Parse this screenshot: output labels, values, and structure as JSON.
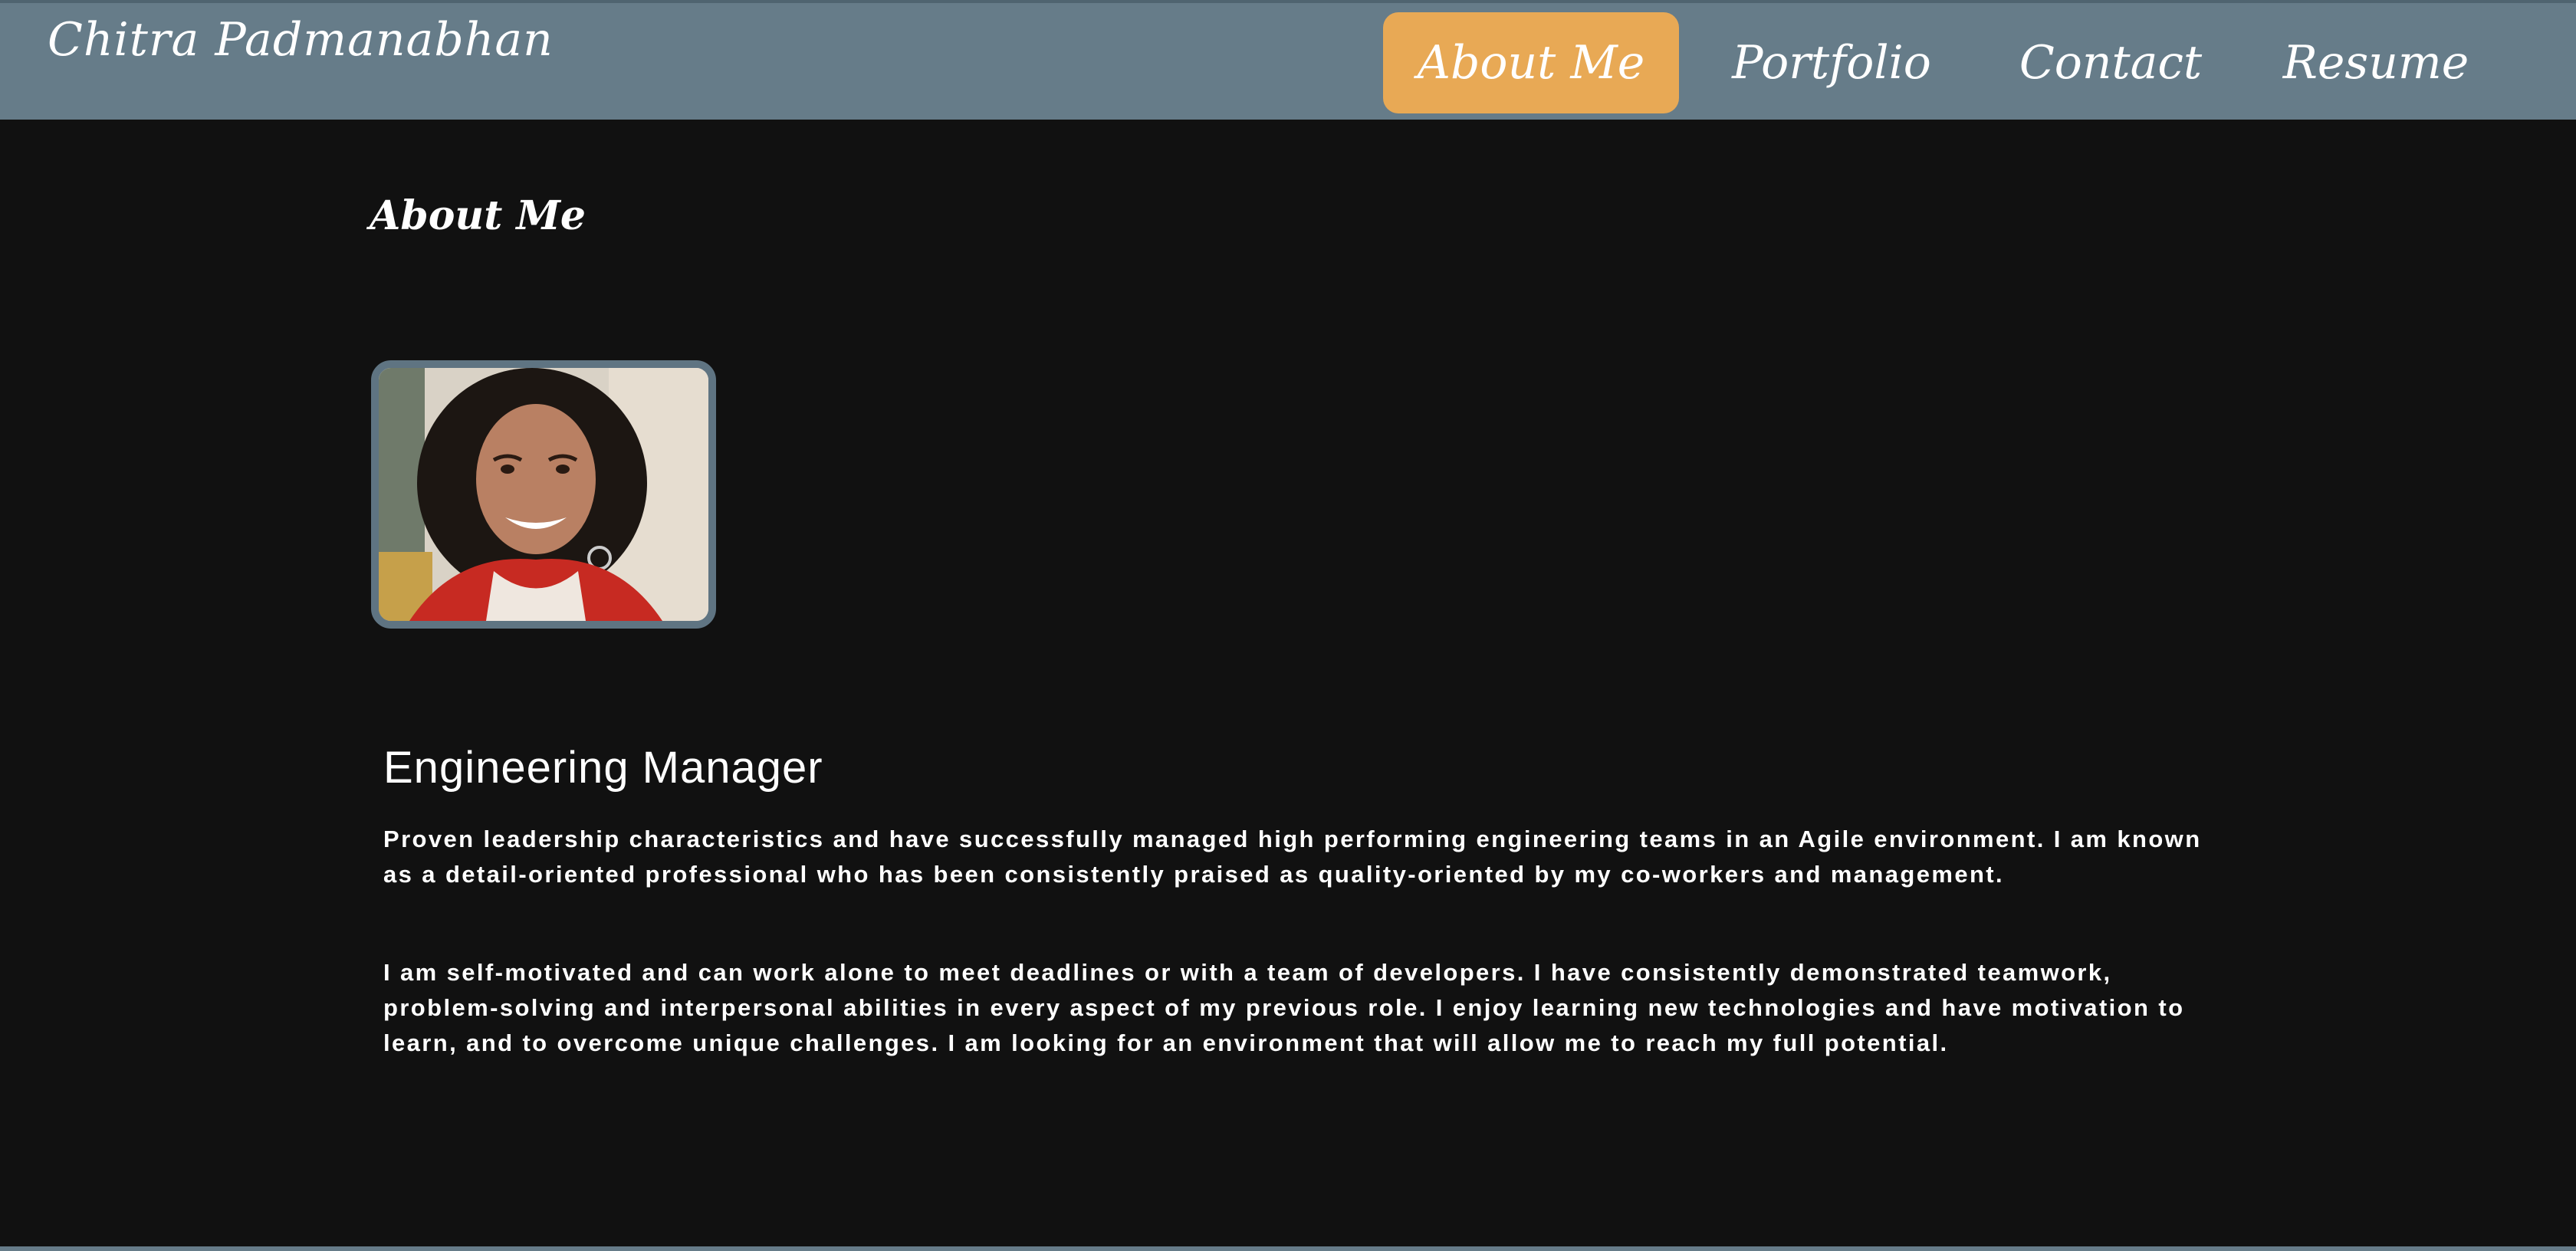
{
  "header": {
    "brand": "Chitra Padmanabhan",
    "nav": [
      {
        "label": "About Me",
        "active": true
      },
      {
        "label": "Portfolio",
        "active": false
      },
      {
        "label": "Contact",
        "active": false
      },
      {
        "label": "Resume",
        "active": false
      }
    ]
  },
  "about": {
    "section_title": "About Me",
    "photo_icon": "profile-photo",
    "job_title": "Engineering Manager",
    "paragraphs": [
      "Proven leadership characteristics and have successfully managed high performing engineering teams in an Agile environment. I am known as a detail-oriented professional who has been consistently praised as quality-oriented by my co-workers and management.",
      "I am self-motivated and can work alone to meet deadlines or with a team of developers. I have consistently demonstrated teamwork, problem-solving and interpersonal abilities in every aspect of my previous role. I enjoy learning new technologies and have motivation to learn, and to overcome unique challenges. I am looking for an environment that will allow me to reach my full potential."
    ]
  },
  "colors": {
    "header_bg": "#667c89",
    "active_nav_bg": "#e8a955",
    "page_bg": "#111111",
    "text": "#ffffff"
  }
}
